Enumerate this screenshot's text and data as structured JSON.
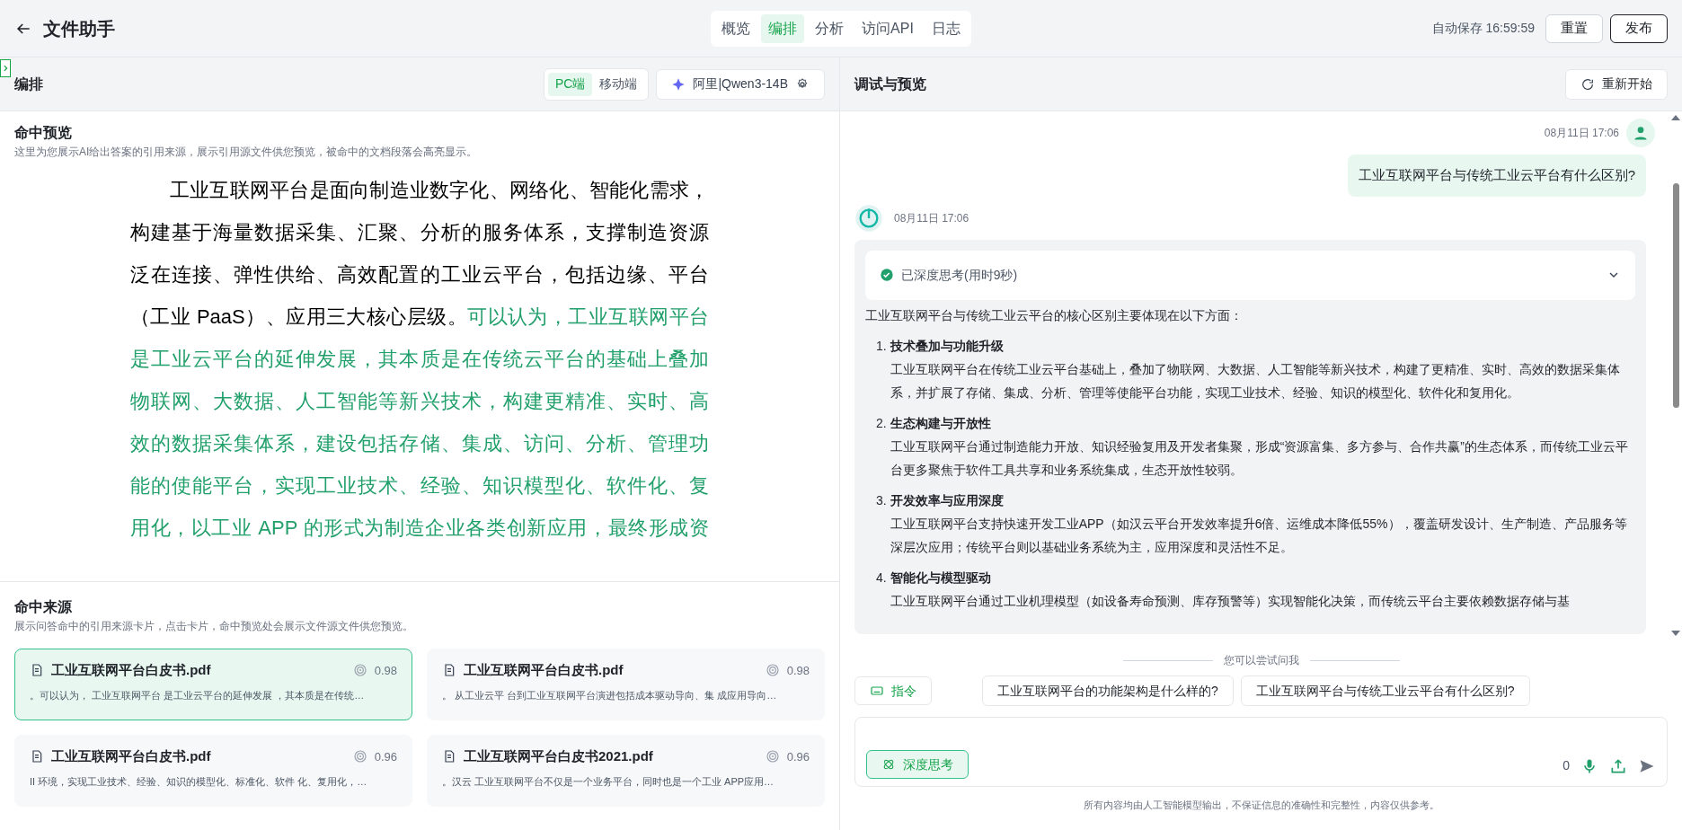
{
  "header": {
    "title": "文件助手",
    "tabs": [
      {
        "label": "概览",
        "selected": false
      },
      {
        "label": "编排",
        "selected": true
      },
      {
        "label": "分析",
        "selected": false
      },
      {
        "label": "访问API",
        "selected": false
      },
      {
        "label": "日志",
        "selected": false
      }
    ],
    "autosave": "自动保存 16:59:59",
    "buttons": [
      {
        "label": "重置",
        "kind": "plain"
      },
      {
        "label": "发布",
        "kind": "strong"
      }
    ]
  },
  "left": {
    "title": "编排",
    "device_toggle": [
      {
        "label": "PC端",
        "selected": true
      },
      {
        "label": "移动端",
        "selected": false
      }
    ],
    "model": "阿里|Qwen3-14B",
    "preview": {
      "title": "命中预览",
      "description": "这里为您展示AI给出答案的引用来源，展示引用源文件供您预览，被命中的文档段落会高亮显示。",
      "lines": [
        {
          "segments": [
            {
              "text": "工业互联网平台是面向制造业数字化、网络化、智能化需求，",
              "highlighted": false
            }
          ]
        },
        {
          "segments": [
            {
              "text": "构建基于海量数据采集、汇聚、分析的服务体系，支撑制造资源",
              "highlighted": false
            }
          ]
        },
        {
          "segments": [
            {
              "text": "泛在连接、弹性供给、高效配置的工业云平台，包括边缘、平台",
              "highlighted": false
            }
          ]
        },
        {
          "segments": [
            {
              "text": "（工业 PaaS）、应用三大核心层级。",
              "highlighted": false
            },
            {
              "text": "可以认为，工业互联网平台",
              "highlighted": true
            }
          ]
        },
        {
          "segments": [
            {
              "text": "是工业云平台的延伸发展，其本质是在传统云平台的基础上叠加",
              "highlighted": true
            }
          ]
        },
        {
          "segments": [
            {
              "text": "物联网、大数据、人工智能等新兴技术，构建更精准、实时、高",
              "highlighted": true
            }
          ]
        },
        {
          "segments": [
            {
              "text": "效的数据采集体系，建设包括存储、集成、访问、分析、管理功",
              "highlighted": true
            }
          ]
        },
        {
          "segments": [
            {
              "text": "能的使能平台，实现工业技术、经验、知识模型化、软件化、复",
              "highlighted": true
            }
          ]
        },
        {
          "segments": [
            {
              "text": "用化，以工业 APP 的形式为制造企业各类创新应用，最终形成资",
              "highlighted": true
            }
          ]
        }
      ]
    },
    "sources": {
      "title": "命中来源",
      "description": "展示问答命中的引用来源卡片，点击卡片，命中预览处会展示文件源文件供您预览。",
      "cards": [
        {
          "name": "工业互联网平台白皮书.pdf",
          "score": "0.98",
          "excerpt": "。可以认为， 工业互联网平台 是工业云平台的延伸发展 ，其本质是在传统…",
          "selected": true
        },
        {
          "name": "工业互联网平台白皮书.pdf",
          "score": "0.98",
          "excerpt": "。 从工业云平 台到工业互联网平台演进包括成本驱动导向、集 成应用导向…",
          "selected": false
        },
        {
          "name": "工业互联网平台白皮书.pdf",
          "score": "0.96",
          "excerpt": "II 环境，实现工业技术、经验、知识的模型化、标准化、软件 化、复用化，…",
          "selected": false
        },
        {
          "name": "工业互联网平台白皮书2021.pdf",
          "score": "0.96",
          "excerpt": "。汉云 工业互联网平台不仅是一个业务平台，同时也是一个工业 APP应用…",
          "selected": false
        }
      ]
    }
  },
  "right": {
    "title": "调试与预览",
    "restart": "重新开始",
    "messages": [
      {
        "kind": "user",
        "time": "08月11日 17:06",
        "text": "工业互联网平台与传统工业云平台有什么区别?"
      },
      {
        "kind": "assistant",
        "time": "08月11日 17:06",
        "thinking": "已深度思考(用时9秒)",
        "expanded": false,
        "intro": "工业互联网平台与传统工业云平台的核心区别主要体现在以下方面：",
        "points": [
          {
            "number": "1.",
            "heading": "技术叠加与功能升级",
            "body": "工业互联网平台在传统工业云平台基础上，叠加了物联网、大数据、人工智能等新兴技术，构建了更精准、实时、高效的数据采集体系，并扩展了存储、集成、分析、管理等使能平台功能，实现工业技术、经验、知识的模型化、软件化和复用化。"
          },
          {
            "number": "2.",
            "heading": "生态构建与开放性",
            "body": "工业互联网平台通过制造能力开放、知识经验复用及开发者集聚，形成“资源富集、多方参与、合作共赢”的生态体系，而传统工业云平台更多聚焦于软件工具共享和业务系统集成，生态开放性较弱。"
          },
          {
            "number": "3.",
            "heading": "开发效率与应用深度",
            "body": "工业互联网平台支持快速开发工业APP（如汉云平台开发效率提升6倍、运维成本降低55%），覆盖研发设计、生产制造、产品服务等深层次应用；传统平台则以基础业务系统为主，应用深度和灵活性不足。"
          },
          {
            "number": "4.",
            "heading": "智能化与模型驱动",
            "body": "工业互联网平台通过工业机理模型（如设备寿命预测、库存预警等）实现智能化决策，而传统云平台主要依赖数据存储与基"
          }
        ]
      }
    ],
    "suggest_label": "您可以尝试问我",
    "command": "指令",
    "suggestions": [
      "工业互联网平台的功能架构是什么样的?",
      "工业互联网平台与传统工业云平台有什么区别?"
    ],
    "deep_think": {
      "label": "深度思考",
      "on": true
    },
    "count": "0",
    "disclaimer": "所有内容均由人工智能模型输出，不保证信息的准确性和完整性，内容仅供参考。"
  }
}
